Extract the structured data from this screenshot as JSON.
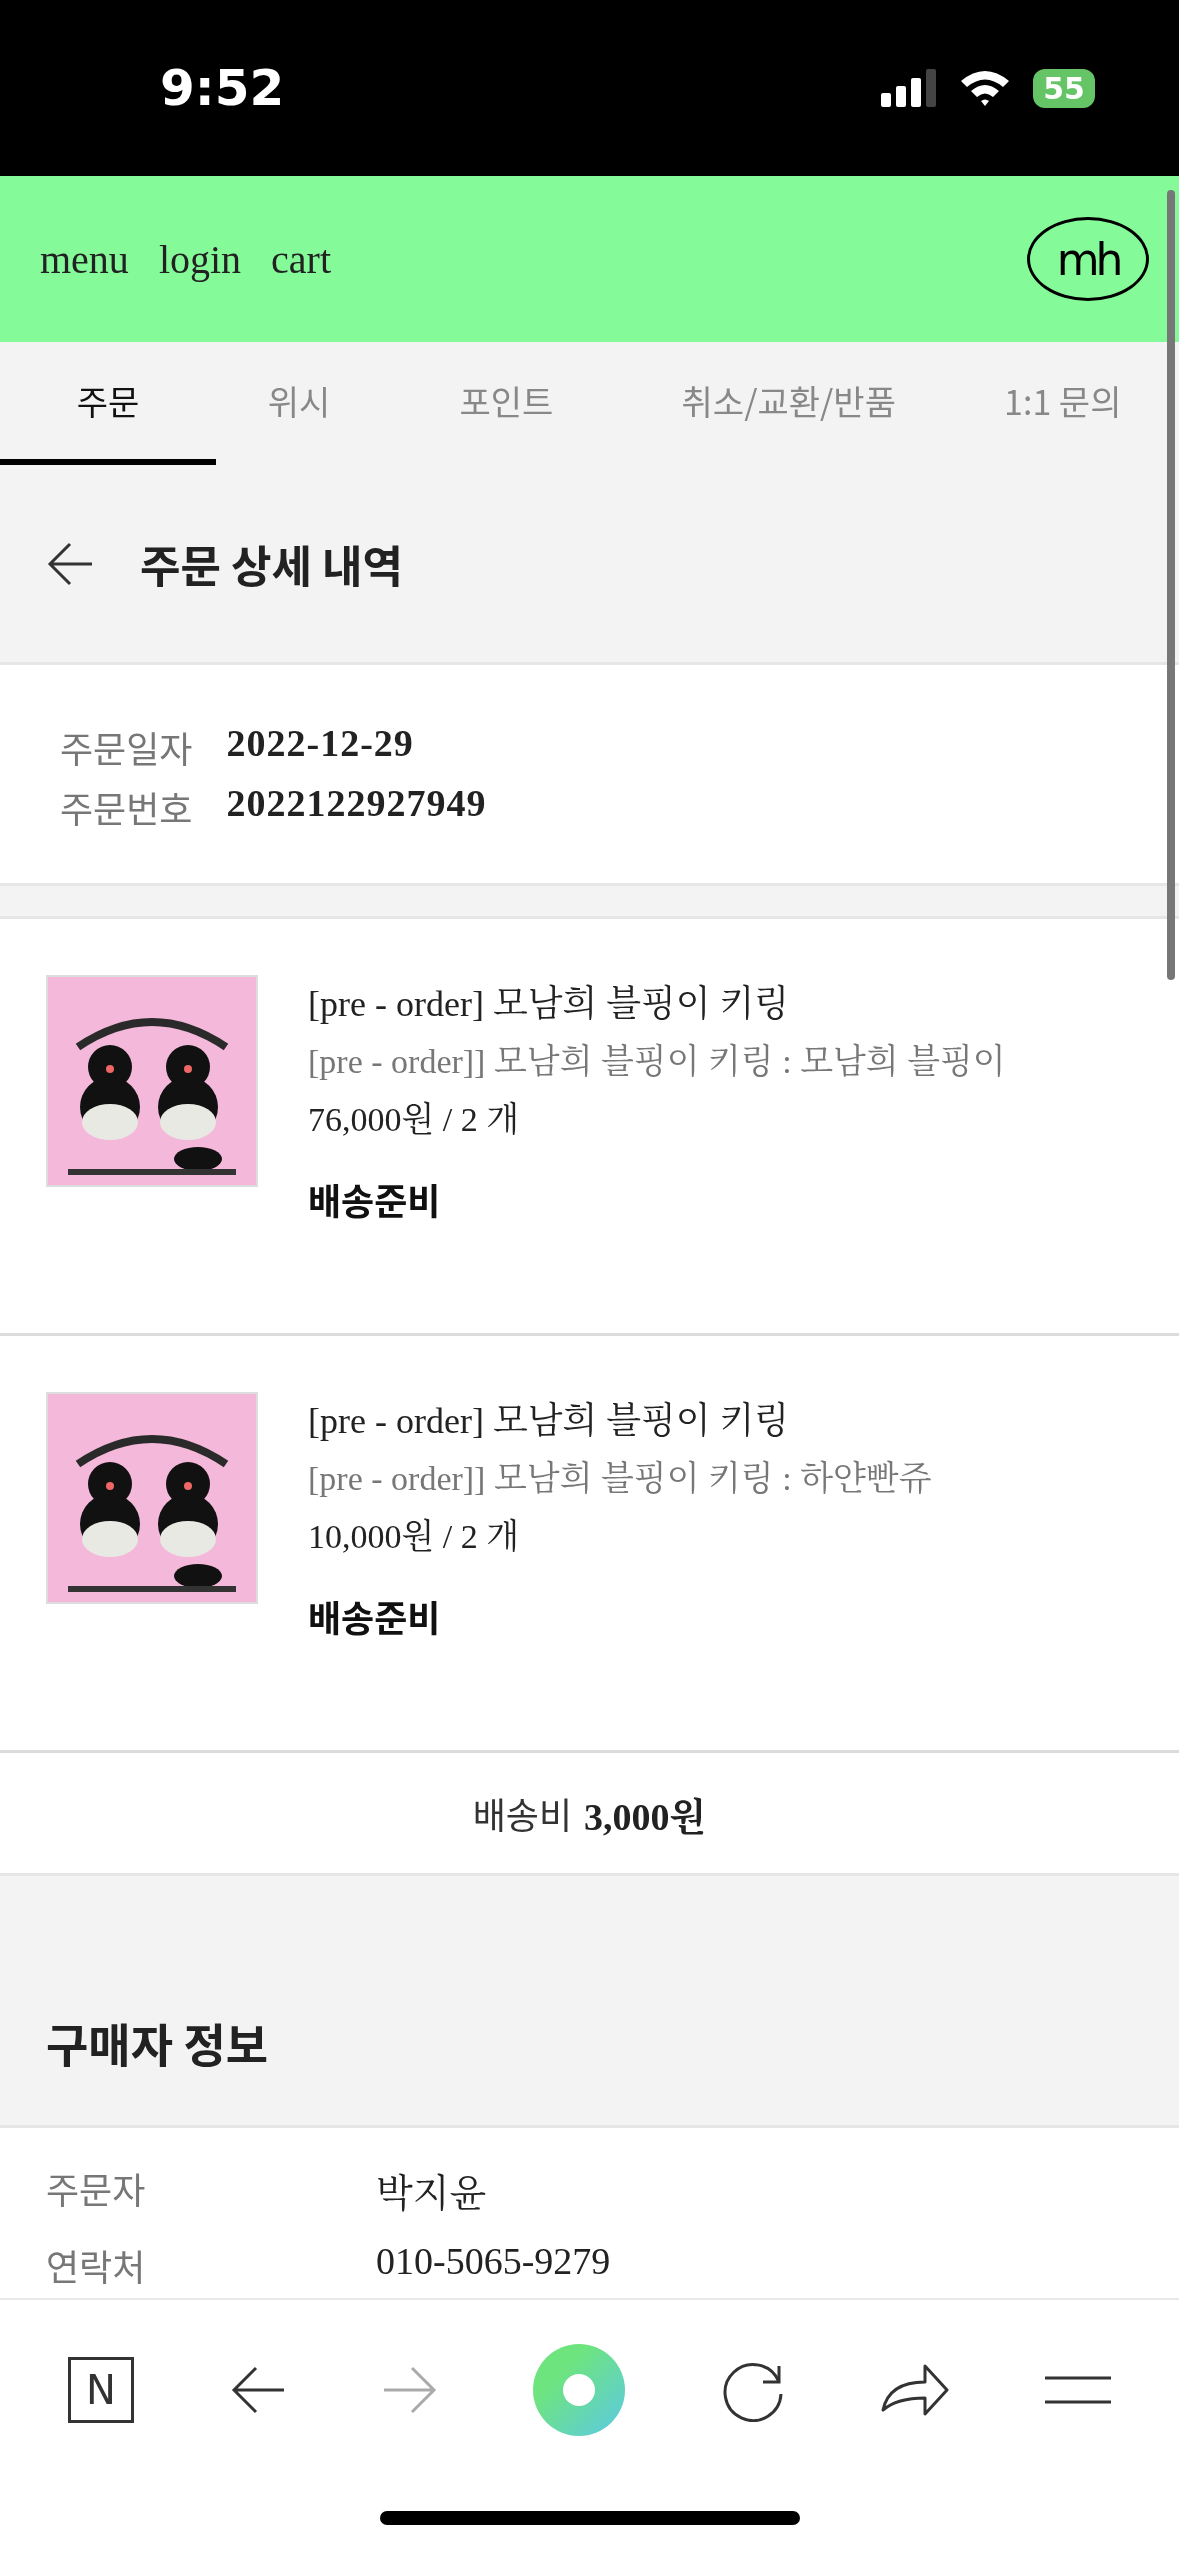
{
  "status_bar": {
    "time": "9:52",
    "battery": "55"
  },
  "header": {
    "links": [
      "menu",
      "login",
      "cart"
    ],
    "logo": "mh"
  },
  "tabs": [
    {
      "label": "주문",
      "selected": true
    },
    {
      "label": "위시",
      "selected": false
    },
    {
      "label": "포인트",
      "selected": false
    },
    {
      "label": "취소/교환/반품",
      "selected": false
    },
    {
      "label": "1:1 문의",
      "selected": false
    }
  ],
  "page_title": "주문 상세 내역",
  "order_info": [
    {
      "label": "주문일자",
      "value": "2022-12-29"
    },
    {
      "label": "주문번호",
      "value": "2022122927949"
    }
  ],
  "items": [
    {
      "name": "[pre - order] 모남희 블핑이 키링",
      "option": "[pre - order]] 모남희 블핑이 키링 : 모남희 블핑이",
      "price": "76,000원 / 2 개",
      "status": "배송준비"
    },
    {
      "name": "[pre - order] 모남희 블핑이 키링",
      "option": "[pre - order]] 모남희 블핑이 키링 : 하얀빤쥬",
      "price": "10,000원 / 2 개",
      "status": "배송준비"
    }
  ],
  "shipping": {
    "label": "배송비",
    "value": "3,000원"
  },
  "buyer_section": {
    "title": "구매자 정보",
    "rows": [
      {
        "label": "주문자",
        "value": "박지윤"
      },
      {
        "label": "연락처",
        "value": "010-5065-9279"
      }
    ]
  },
  "browser_bar": {
    "home_letter": "N"
  }
}
